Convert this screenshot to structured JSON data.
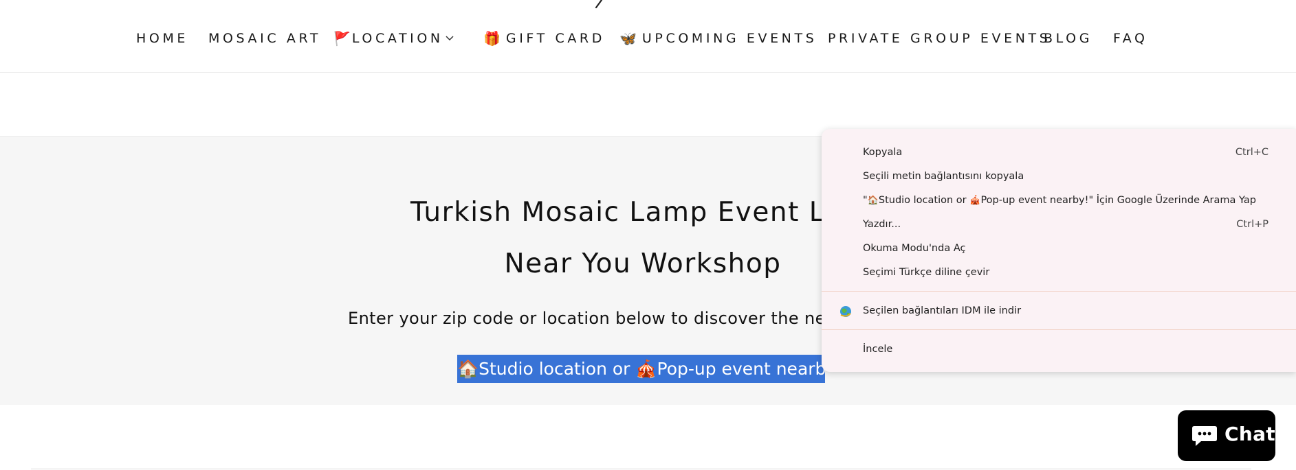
{
  "nav": {
    "items": [
      {
        "label": "HOME",
        "icon": ""
      },
      {
        "label": "MOSAIC ART",
        "icon": ""
      },
      {
        "label": "LOCATION",
        "icon": "🚩",
        "has_dropdown": true
      },
      {
        "label": "GIFT CARD",
        "icon": "🎁"
      },
      {
        "label": "UPCOMING EVENTS",
        "icon": "🦋"
      },
      {
        "label": "PRIVATE GROUP EVENTS",
        "icon": ""
      },
      {
        "label": "BLOG",
        "icon": ""
      },
      {
        "label": "FAQ",
        "icon": ""
      }
    ]
  },
  "hero": {
    "title_line1": "Turkish Mosaic Lamp Event Loca",
    "title_line2": "Near You Workshop",
    "subtitle": "Enter your zip code or location below to discover the neares",
    "highlight": {
      "emoji1": "🏠",
      "text1": "Studio location or ",
      "emoji2": "🎪",
      "text2": "Pop-up event nearby!"
    },
    "selection_color": "#3873d6",
    "background": "#f6f6f6"
  },
  "context_menu": {
    "background": "#fbf2f5",
    "items": [
      {
        "label": "Kopyala",
        "shortcut": "Ctrl+C"
      },
      {
        "label": "Seçili metin bağlantısını kopyala",
        "shortcut": ""
      },
      {
        "label_prefix": "\"",
        "label_emoji1": "🏠",
        "label_text1": "Studio location or ",
        "label_emoji2": "🎪",
        "label_text2": "Pop-up event nearby!\" İçin Google Üzerinde Arama Yap",
        "shortcut": ""
      },
      {
        "label": "Yazdır...",
        "shortcut": "Ctrl+P"
      },
      {
        "label": "Okuma Modu'nda Aç",
        "shortcut": ""
      },
      {
        "label": "Seçimi Türkçe diline çevir",
        "shortcut": ""
      },
      {
        "label": "Seçilen bağlantıları IDM ile indir",
        "shortcut": "",
        "icon": "idm-globe-icon"
      },
      {
        "label": "İncele",
        "shortcut": ""
      }
    ]
  },
  "chat": {
    "label": "Chat",
    "icon": "chat-bubble-icon"
  }
}
